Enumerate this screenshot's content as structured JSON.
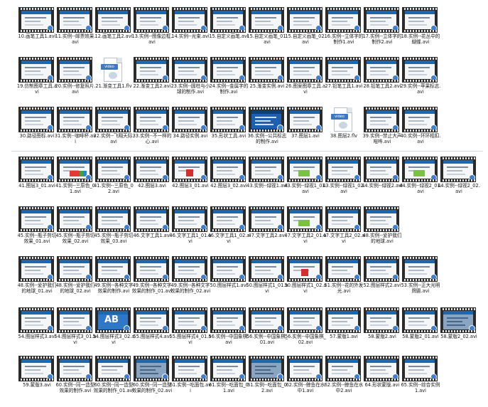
{
  "files": [
    {
      "name": "10.画笔工具1.avi",
      "kind": "video"
    },
    {
      "name": "11.实例--邮票效果.avi",
      "kind": "video"
    },
    {
      "name": "12.画笔工具2.avi",
      "kind": "video"
    },
    {
      "name": "13.实例--图像边框.avi",
      "kind": "video"
    },
    {
      "name": "14.实例--光束.avi",
      "kind": "video"
    },
    {
      "name": "15.自定义画笔.avi",
      "kind": "video"
    },
    {
      "name": "15.自定义画笔_01.avi",
      "kind": "video"
    },
    {
      "name": "15.自定义画笔_02.avi",
      "kind": "video",
      "thumb": "plain"
    },
    {
      "name": "16.实例--立体字的制作1.avi",
      "kind": "video"
    },
    {
      "name": "17.实例--立体字的制作2.avi",
      "kind": "video"
    },
    {
      "name": "18.实例--花丛中的蝴蝶.avi",
      "kind": "video"
    },
    {
      "name": "19.仿制图章工具.avi",
      "kind": "video"
    },
    {
      "name": "20.实例--修复照片.avi",
      "kind": "video"
    },
    {
      "name": "21.渐变工具1.flv",
      "kind": "flv"
    },
    {
      "name": "22.渐变工具2.avi",
      "kind": "video"
    },
    {
      "name": "23.实例--圆柱与小球的制作.avi",
      "kind": "video"
    },
    {
      "name": "24.实例--金属字的制作.avi",
      "kind": "video"
    },
    {
      "name": "25.渐变实例.avi",
      "kind": "video"
    },
    {
      "name": "26.图案图章工具.avi",
      "kind": "video"
    },
    {
      "name": "27.铅笔工具1.avi",
      "kind": "video"
    },
    {
      "name": "28.铅笔工具2.avi",
      "kind": "video"
    },
    {
      "name": "29.实例--苹果标志.avi",
      "kind": "video"
    },
    {
      "name": "30.路径图标.avi",
      "kind": "video"
    },
    {
      "name": "31.实例--咖啡杯.avi",
      "kind": "video"
    },
    {
      "name": "32.实例--飞翔天际.avi",
      "kind": "video"
    },
    {
      "name": "33.实例--不一样的心.avi",
      "kind": "video"
    },
    {
      "name": "34.路径实例.avi",
      "kind": "video"
    },
    {
      "name": "35.形状工具.avi",
      "kind": "video"
    },
    {
      "name": "36.实例--公共标志的制作.avi",
      "kind": "video",
      "thumb": "dark"
    },
    {
      "name": "37.图层1.avi",
      "kind": "video"
    },
    {
      "name": "38.图层2.flv",
      "kind": "flv"
    },
    {
      "name": "39.实例--禁止大声喧哗.avi",
      "kind": "video"
    },
    {
      "name": "40.实例--环环相扣.avi",
      "kind": "video"
    },
    {
      "name": "41.图层3_01.avi",
      "kind": "video"
    },
    {
      "name": "41.实例--三原色_01.avi",
      "kind": "video",
      "thumb": "color"
    },
    {
      "name": "41.实例--三原色_02.avi",
      "kind": "video"
    },
    {
      "name": "42.图层3.avi",
      "kind": "video"
    },
    {
      "name": "42.图层3_01.avi",
      "kind": "video",
      "thumb": "red"
    },
    {
      "name": "42.图层3_02.avi",
      "kind": "video"
    },
    {
      "name": "43.实例--绿视1.avi",
      "kind": "video"
    },
    {
      "name": "43.实例--绿视1_01.avi",
      "kind": "video",
      "thumb": "green"
    },
    {
      "name": "43.实例--绿视1_02.avi",
      "kind": "video"
    },
    {
      "name": "44.实例--绿视2.avi",
      "kind": "video"
    },
    {
      "name": "44.实例--绿视2_01.avi",
      "kind": "video",
      "thumb": "green"
    },
    {
      "name": "44.实例--绿视2_02.avi",
      "kind": "video"
    },
    {
      "name": "45.实例--瓶子剪切效果_01.avi",
      "kind": "video"
    },
    {
      "name": "45.实例--瓶子剪切效果_02.avi",
      "kind": "video"
    },
    {
      "name": "45.实例--瓶子剪切效果_03.avi",
      "kind": "video",
      "thumb": "plain"
    },
    {
      "name": "46.文字工具1.avi",
      "kind": "video"
    },
    {
      "name": "46.文字工具1_01.avi",
      "kind": "video"
    },
    {
      "name": "46.文字工具1_02.avi",
      "kind": "video"
    },
    {
      "name": "47.文字工具2.avi",
      "kind": "video"
    },
    {
      "name": "47.文字工具2_01.avi",
      "kind": "video",
      "thumb": "green"
    },
    {
      "name": "47.文字工具2_02.avi",
      "kind": "video"
    },
    {
      "name": "48.实例--爱护我们的地球.avi",
      "kind": "video"
    },
    {
      "name": "48.实例--爱护我们的地球_01.avi",
      "kind": "video"
    },
    {
      "name": "48.实例--爱护我们的地球_02.avi",
      "kind": "video",
      "thumb": "plain"
    },
    {
      "name": "49.实例--各种文字效果的制作.avi",
      "kind": "video"
    },
    {
      "name": "49.实例--各种文字效果的制作_01.avi",
      "kind": "video"
    },
    {
      "name": "49.实例--各种文字效果的制作_02.avi",
      "kind": "video"
    },
    {
      "name": "50.图层样式1.avi",
      "kind": "video"
    },
    {
      "name": "50.图层样式1_01.avi",
      "kind": "video"
    },
    {
      "name": "50.图层样式1_02.avi",
      "kind": "video",
      "thumb": "red"
    },
    {
      "name": "51.实例--花的外发光.avi",
      "kind": "video"
    },
    {
      "name": "52.图层样式2.avi",
      "kind": "video"
    },
    {
      "name": "53.实例--正大光明牌匾.avi",
      "kind": "video"
    },
    {
      "name": "54.图层样式3.avi",
      "kind": "video"
    },
    {
      "name": "54.图层样式3_01.avi",
      "kind": "video"
    },
    {
      "name": "54.图层样式3_02.avi",
      "kind": "video",
      "thumb": "ab"
    },
    {
      "name": "55.图层样式4.avi",
      "kind": "video"
    },
    {
      "name": "55.图层样式4_01.avi",
      "kind": "video"
    },
    {
      "name": "56.实例--中国象棋.avi",
      "kind": "video"
    },
    {
      "name": "56.实例--中国象棋_01.avi",
      "kind": "video"
    },
    {
      "name": "56.实例--中国象棋_02.avi",
      "kind": "video",
      "thumb": "plain"
    },
    {
      "name": "57.蒙版1.avi",
      "kind": "video"
    },
    {
      "name": "58.蒙版2.avi",
      "kind": "video"
    },
    {
      "name": "58.蒙版2_01.avi",
      "kind": "video"
    },
    {
      "name": "58.蒙版2_02.avi",
      "kind": "video",
      "thumb": "photo"
    },
    {
      "name": "59.蒙版3.avi",
      "kind": "video"
    },
    {
      "name": "60.实例--同一造型效果的制作.avi",
      "kind": "video"
    },
    {
      "name": "60.实例--同一造型效果的制作_01.avi",
      "kind": "video"
    },
    {
      "name": "60.实例--同一造型效果的制作_02.avi",
      "kind": "video",
      "thumb": "photo"
    },
    {
      "name": "61.实例--吃面包.avi",
      "kind": "video"
    },
    {
      "name": "61.实例--吃面包_01.avi",
      "kind": "video"
    },
    {
      "name": "61.实例--吃面包_02.avi",
      "kind": "video",
      "thumb": "photo"
    },
    {
      "name": "62.实例--鲸鱼在水中1.avi",
      "kind": "video"
    },
    {
      "name": "62.实例--鲸鱼在水中2.avi",
      "kind": "video"
    },
    {
      "name": "64.形状蒙版.avi",
      "kind": "video"
    },
    {
      "name": "65.实例--综合实例1.avi",
      "kind": "video"
    }
  ],
  "flv_tag": "video"
}
